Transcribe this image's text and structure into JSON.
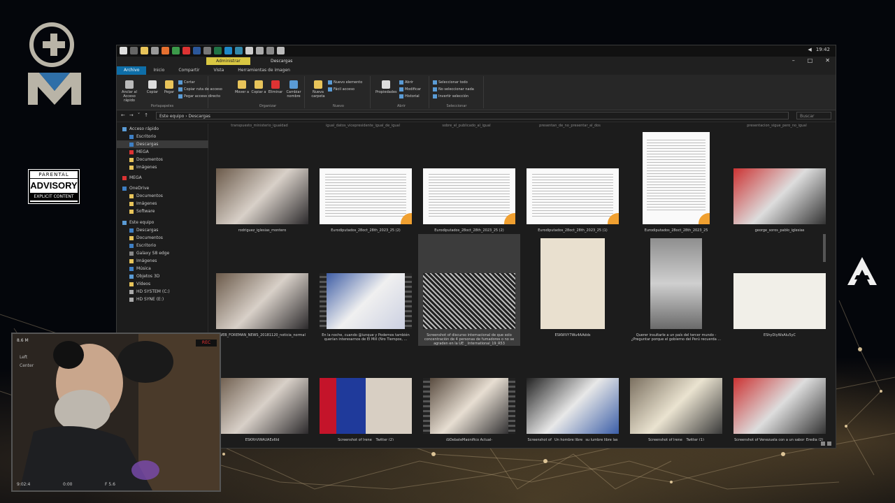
{
  "colors": {
    "accent": "#0e6ea8",
    "context_tab": "#d9c742",
    "recording": "#e33333"
  },
  "window": {
    "clock": "19:42",
    "context_tab_label": "Administrar",
    "tab_title": "Descargas",
    "ribbon_tabs": [
      "Archivo",
      "Inicio",
      "Compartir",
      "Vista",
      "Herramientas de imagen"
    ],
    "ribbon": {
      "clipboard": {
        "pin_label": "Anclar al Acceso rápido",
        "copy_label": "Copiar",
        "paste_label": "Pegar",
        "cut_label": "Cortar",
        "copy_path_label": "Copiar ruta de acceso",
        "paste_shortcut_label": "Pegar acceso directo",
        "group_label": "Portapapeles"
      },
      "organize": {
        "move_label": "Mover a",
        "copy_to_label": "Copiar a",
        "delete_label": "Eliminar",
        "rename_label": "Cambiar nombre",
        "group_label": "Organizar"
      },
      "new": {
        "new_folder_label": "Nueva carpeta",
        "new_item_label": "Nuevo elemento",
        "easy_access_label": "Fácil acceso",
        "group_label": "Nuevo"
      },
      "open": {
        "properties_label": "Propiedades",
        "open_label": "Abrir",
        "edit_label": "Modificar",
        "history_label": "Historial",
        "group_label": "Abrir"
      },
      "select": {
        "select_all_label": "Seleccionar todo",
        "select_none_label": "No seleccionar nada",
        "invert_label": "Invertir selección",
        "group_label": "Seleccionar"
      }
    },
    "address": {
      "path": "Este equipo  ›  Descargas",
      "search_placeholder": "Buscar"
    },
    "nav_items": [
      {
        "label": "Acceso rápido",
        "pinned": false
      },
      {
        "label": "Escritorio",
        "pinned": true
      },
      {
        "label": "Descargas",
        "pinned": true
      },
      {
        "label": "MEGA",
        "pinned": true
      },
      {
        "label": "Documentos",
        "pinned": true
      },
      {
        "label": "Imágenes",
        "pinned": true
      },
      {
        "label": "MEGA",
        "pinned": false
      },
      {
        "label": "OneDrive",
        "pinned": false
      },
      {
        "label": "Documentos",
        "pinned": false
      },
      {
        "label": "Imágenes",
        "pinned": false
      },
      {
        "label": "Software",
        "pinned": false
      },
      {
        "label": "Este equipo",
        "pinned": false
      },
      {
        "label": "Descargas",
        "pinned": false
      },
      {
        "label": "Documentos",
        "pinned": false
      },
      {
        "label": "Escritorio",
        "pinned": false
      },
      {
        "label": "Galaxy S8 edge",
        "pinned": false
      },
      {
        "label": "Imágenes",
        "pinned": false
      },
      {
        "label": "Música",
        "pinned": false
      },
      {
        "label": "Objetos 3D",
        "pinned": false
      },
      {
        "label": "Vídeos",
        "pinned": false
      },
      {
        "label": "HD SYSTEM (C:)",
        "pinned": false
      },
      {
        "label": "HD SYNE (E:)",
        "pinned": false
      }
    ],
    "files": [
      {
        "caption": "rodriguez_iglesias_montero",
        "type": "photo"
      },
      {
        "caption": "Eurodiputados_28oct_28th_2023_25 (2)",
        "type": "doc"
      },
      {
        "caption": "Eurodiputados_28oct_28th_2023_25 (2)",
        "type": "doc"
      },
      {
        "caption": "Eurodiputados_28oct_28th_2023_25 (1)",
        "type": "doc"
      },
      {
        "caption": "Eurodiputados_28oct_28th_2023_25",
        "type": "doc"
      },
      {
        "caption": "george_soros_pablo_iglesias",
        "type": "photo"
      },
      {
        "caption": "WEB_FOREMAN_NEWS_20181120_noticia_normal",
        "type": "photo"
      },
      {
        "caption": "En la noche, cuando @iunque y Podemos también querían interesarnos de El Mill (Nro Tiempos, ...",
        "type": "video"
      },
      {
        "caption": "Screenshot of discurso internacional de que solo concentración de 4 personas de fumadores o no se agraden en la UE _ International_19_R53",
        "type": "photo"
      },
      {
        "caption": "ESKWVY7Wu4AAdds",
        "type": "photo"
      },
      {
        "caption": "Querer insultarle a un país del tercer mundo - ¿Preguntar porque el gobierno del Perú recuerda ...",
        "type": "photo"
      },
      {
        "caption": "EShyDiyWsAIu5yC",
        "type": "photo"
      },
      {
        "caption": "ESKRhVWAUAEx6Jd",
        "type": "photo"
      },
      {
        "caption": "Screenshot of Irene _ Twitter (2)",
        "type": "photo"
      },
      {
        "caption": "@DebateMagnifico Actual-",
        "type": "video"
      },
      {
        "caption": "Screenshot of _Un hombre libre_ su lumbre libre las declaraciones de Ábalos de Toledo sobre a la Leelo - Libertad 1 gfkt",
        "type": "photo"
      },
      {
        "caption": "Screenshot of Irene _ Twitter (1)",
        "type": "photo"
      },
      {
        "caption": "Screenshot of Venezuela con a un sabor_Eredia (2)_ esta autoestil poagan - ElMiPolitico",
        "type": "photo"
      }
    ],
    "top_captions": [
      "transpuesto_ministerio_igualdad",
      "igual_datos_vicepresidente_igual_de_igual",
      "sobre_el_publicado_al_igual",
      "presentan_de_no_presentar_al_dos",
      "",
      "presentacion_sigue_pero_no_igual"
    ]
  },
  "webcam": {
    "top_label": "8.6 M",
    "rec_label": "REC",
    "mode_1": "Left",
    "mode_2": "Center",
    "bottom_left": "9:02:4",
    "bottom_mid": "0:00",
    "bottom_right": "F 5.6"
  },
  "advisory": {
    "line1": "PARENTAL",
    "line2": "ADVISORY",
    "line3": "EXPLICIT CONTENT"
  }
}
